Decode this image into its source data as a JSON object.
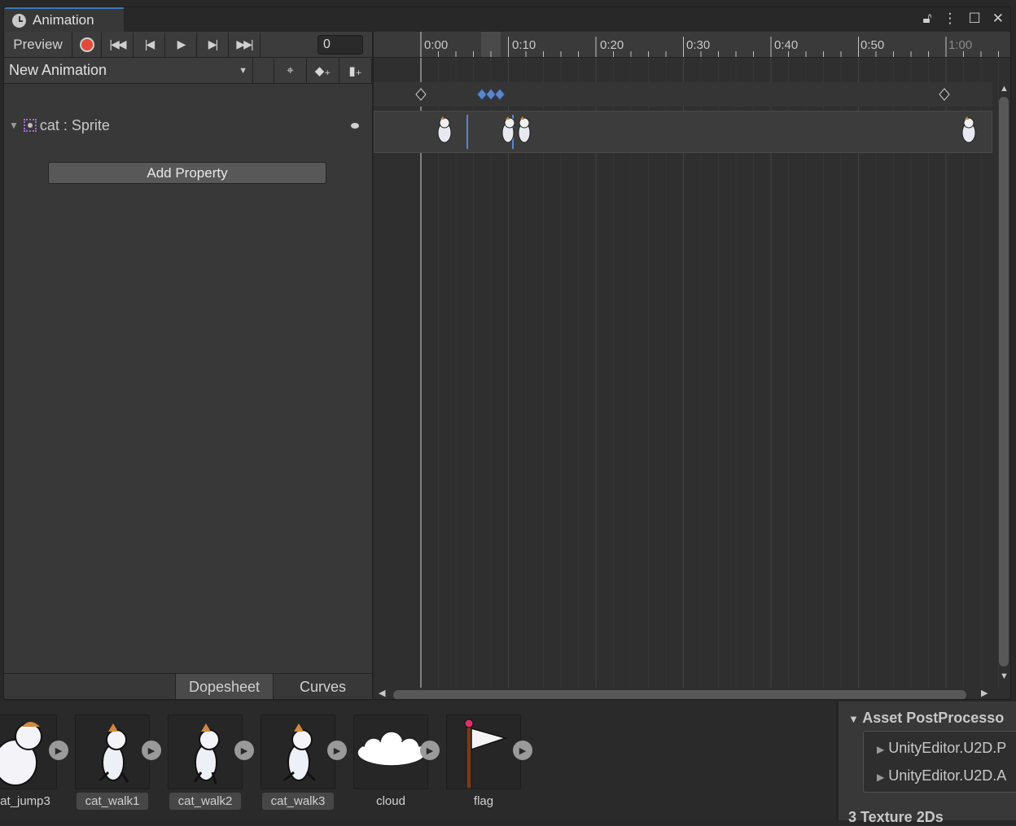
{
  "window": {
    "tab_title": "Animation",
    "icons": [
      "lock-icon",
      "menu-icon",
      "maximize-icon",
      "close-icon"
    ]
  },
  "toolbar": {
    "preview_label": "Preview",
    "frame_value": "0"
  },
  "clip": {
    "name": "New Animation"
  },
  "properties": [
    {
      "label": "cat : Sprite"
    }
  ],
  "add_property_label": "Add Property",
  "bottom_tabs": {
    "dopesheet": "Dopesheet",
    "curves": "Curves"
  },
  "ruler": {
    "labels": [
      "0:00",
      "0:10",
      "0:20",
      "0:30",
      "0:40",
      "0:50",
      "1:00"
    ]
  },
  "assets": [
    {
      "name": "at_jump3",
      "selected": false
    },
    {
      "name": "cat_walk1",
      "selected": true
    },
    {
      "name": "cat_walk2",
      "selected": true
    },
    {
      "name": "cat_walk3",
      "selected": true
    },
    {
      "name": "cloud",
      "selected": false
    },
    {
      "name": "flag",
      "selected": false
    }
  ],
  "inspector": {
    "title": "Asset PostProcesso",
    "items": [
      "UnityEditor.U2D.P",
      "UnityEditor.U2D.A"
    ],
    "bottom_title": "3 Texture 2Ds"
  },
  "colors": {
    "record": "#e04a3a",
    "accent": "#3a79bb",
    "keyframe_selected": "#5b86c9"
  }
}
